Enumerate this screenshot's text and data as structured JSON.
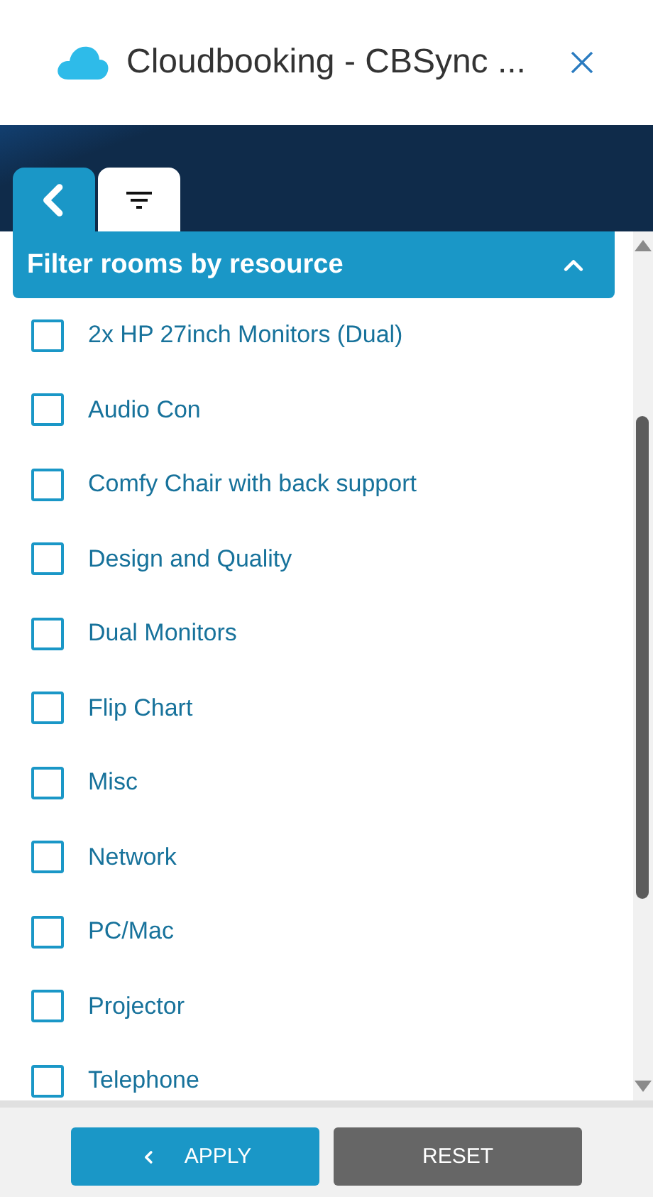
{
  "window": {
    "title": "Cloudbooking - CBSync ..."
  },
  "tabs": [
    {
      "kind": "back",
      "selected": false
    },
    {
      "kind": "filter",
      "selected": true
    }
  ],
  "filter_panel": {
    "title": "Filter rooms by resource",
    "expanded": true,
    "items": [
      {
        "label": "2x HP 27inch Monitors (Dual)",
        "checked": false
      },
      {
        "label": "Audio Con",
        "checked": false
      },
      {
        "label": "Comfy Chair with back support",
        "checked": false
      },
      {
        "label": "Design and Quality",
        "checked": false
      },
      {
        "label": "Dual Monitors",
        "checked": false
      },
      {
        "label": "Flip Chart",
        "checked": false
      },
      {
        "label": "Misc",
        "checked": false
      },
      {
        "label": "Network",
        "checked": false
      },
      {
        "label": "PC/Mac",
        "checked": false
      },
      {
        "label": "Projector",
        "checked": false
      },
      {
        "label": "Telephone",
        "checked": false
      }
    ]
  },
  "buttons": [
    {
      "kind": "apply",
      "label": "APPLY"
    },
    {
      "kind": "reset",
      "label": "RESET"
    }
  ]
}
